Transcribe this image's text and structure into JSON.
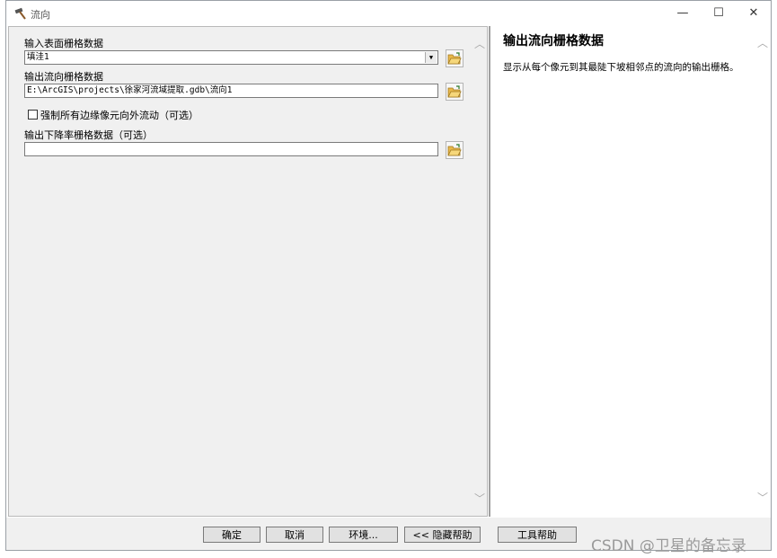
{
  "window": {
    "title": "流向"
  },
  "form": {
    "input_surface_label": "输入表面栅格数据",
    "input_surface_value": "填洼1",
    "output_flow_label": "输出流向栅格数据",
    "output_flow_value": "E:\\ArcGIS\\projects\\徐家河流域提取.gdb\\流向1",
    "force_edge_label": "强制所有边缘像元向外流动（可选）",
    "output_drop_label": "输出下降率栅格数据（可选）",
    "output_drop_value": ""
  },
  "help": {
    "title": "输出流向栅格数据",
    "text": "显示从每个像元到其最陡下坡相邻点的流向的输出栅格。"
  },
  "buttons": {
    "ok": "确定",
    "cancel": "取消",
    "environments": "环境...",
    "hide_help": "<< 隐藏帮助",
    "tool_help": "工具帮助"
  },
  "watermark": "CSDN @卫星的备忘录",
  "icons": [
    "hammer-icon",
    "minimize-icon",
    "maximize-icon",
    "close-icon",
    "folder-open-icon",
    "chevron-down-icon",
    "scroll-up-icon",
    "scroll-down-icon"
  ]
}
